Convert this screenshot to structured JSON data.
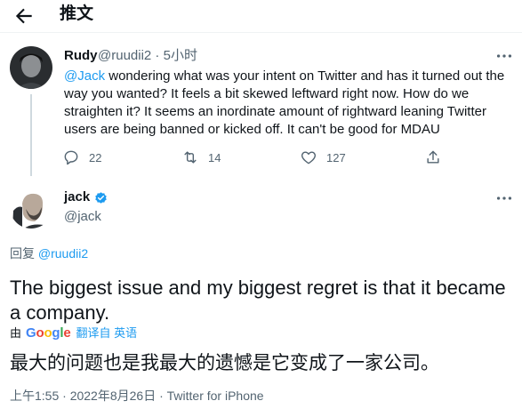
{
  "header": {
    "title": "推文",
    "back_icon": "arrow-left-icon"
  },
  "reply_tweet": {
    "name": "Rudy",
    "handle": "@ruudii2",
    "separator": " · ",
    "time": "5小时",
    "mention": "@Jack",
    "text": " wondering what was your intent on Twitter and has it turned out the way you wanted? It feels a bit skewed leftward right now. How do we straighten it? It seems an inordinate amount of rightward leaning Twitter users are being banned or kicked off. It can't be good for MDAU",
    "replies": "22",
    "retweets": "14",
    "likes": "127"
  },
  "main_tweet": {
    "name": "jack",
    "handle": "@jack",
    "reply_prefix": "回复 ",
    "reply_to": "@ruudii2",
    "text": "The biggest issue and my biggest regret is that it became a company.",
    "translate_by": "由",
    "translate_label": "翻译自 英语",
    "translated_text": "最大的问题也是我最大的遗憾是它变成了一家公司。",
    "meta": "上午1:55 · 2022年8月26日 · Twitter for iPhone"
  },
  "colors": {
    "accent": "#1d9bf0",
    "muted": "#536471",
    "text": "#0f1419"
  }
}
